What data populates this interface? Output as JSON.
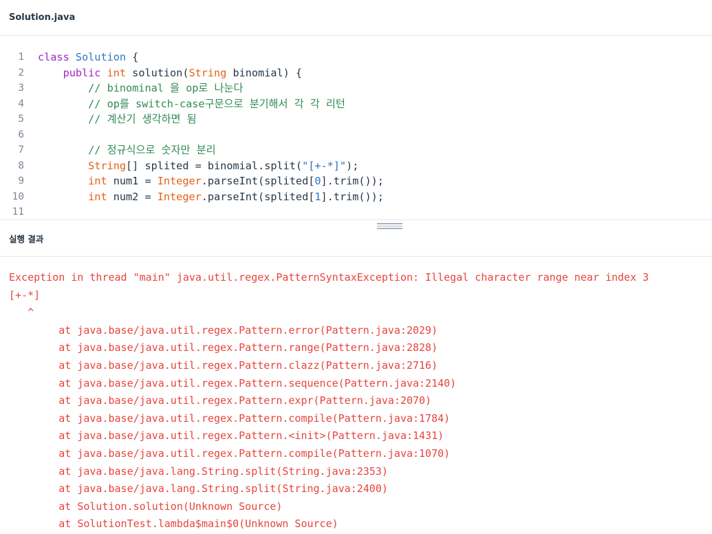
{
  "editor": {
    "file_name": "Solution.java",
    "lines": [
      {
        "no": "1",
        "tokens": [
          {
            "t": "class ",
            "c": "k"
          },
          {
            "t": "Solution",
            "c": "c"
          },
          {
            "t": " {",
            "c": "p"
          }
        ]
      },
      {
        "no": "2",
        "tokens": [
          {
            "t": "    ",
            "c": "p"
          },
          {
            "t": "public ",
            "c": "k"
          },
          {
            "t": "int ",
            "c": "t"
          },
          {
            "t": "solution(",
            "c": "p"
          },
          {
            "t": "String",
            "c": "t"
          },
          {
            "t": " binomial) {",
            "c": "p"
          }
        ]
      },
      {
        "no": "3",
        "tokens": [
          {
            "t": "        // binominal 을 op로 나눈다",
            "c": "m"
          }
        ]
      },
      {
        "no": "4",
        "tokens": [
          {
            "t": "        // op를 switch-case구문으로 분기해서 각 각 리턴",
            "c": "m"
          }
        ]
      },
      {
        "no": "5",
        "tokens": [
          {
            "t": "        // 계산기 생각하면 됨",
            "c": "m"
          }
        ]
      },
      {
        "no": "6",
        "tokens": []
      },
      {
        "no": "7",
        "tokens": [
          {
            "t": "        // 정규식으로 숫자만 분리",
            "c": "m"
          }
        ]
      },
      {
        "no": "8",
        "tokens": [
          {
            "t": "        ",
            "c": "p"
          },
          {
            "t": "String",
            "c": "t"
          },
          {
            "t": "[] splited = binomial.split(",
            "c": "p"
          },
          {
            "t": "\"[+-*]\"",
            "c": "s"
          },
          {
            "t": ");",
            "c": "p"
          }
        ]
      },
      {
        "no": "9",
        "tokens": [
          {
            "t": "        ",
            "c": "p"
          },
          {
            "t": "int",
            "c": "t"
          },
          {
            "t": " num1 = ",
            "c": "p"
          },
          {
            "t": "Integer",
            "c": "t"
          },
          {
            "t": ".parseInt(splited[",
            "c": "p"
          },
          {
            "t": "0",
            "c": "n"
          },
          {
            "t": "].trim());",
            "c": "p"
          }
        ]
      },
      {
        "no": "10",
        "tokens": [
          {
            "t": "        ",
            "c": "p"
          },
          {
            "t": "int",
            "c": "t"
          },
          {
            "t": " num2 = ",
            "c": "p"
          },
          {
            "t": "Integer",
            "c": "t"
          },
          {
            "t": ".parseInt(splited[",
            "c": "p"
          },
          {
            "t": "1",
            "c": "n"
          },
          {
            "t": "].trim());",
            "c": "p"
          }
        ]
      },
      {
        "no": "11",
        "tokens": []
      }
    ]
  },
  "result": {
    "title": "실행 결과",
    "lines": [
      "Exception in thread \"main\" java.util.regex.PatternSyntaxException: Illegal character range near index 3",
      "[+-*]",
      "   ^",
      "        at java.base/java.util.regex.Pattern.error(Pattern.java:2029)",
      "        at java.base/java.util.regex.Pattern.range(Pattern.java:2828)",
      "        at java.base/java.util.regex.Pattern.clazz(Pattern.java:2716)",
      "        at java.base/java.util.regex.Pattern.sequence(Pattern.java:2140)",
      "        at java.base/java.util.regex.Pattern.expr(Pattern.java:2070)",
      "        at java.base/java.util.regex.Pattern.compile(Pattern.java:1784)",
      "        at java.base/java.util.regex.Pattern.<init>(Pattern.java:1431)",
      "        at java.base/java.util.regex.Pattern.compile(Pattern.java:1070)",
      "        at java.base/java.lang.String.split(String.java:2353)",
      "        at java.base/java.lang.String.split(String.java:2400)",
      "        at Solution.solution(Unknown Source)",
      "        at SolutionTest.lambda$main$0(Unknown Source)"
    ]
  },
  "colors": {
    "error_text": "#e6443c",
    "keyword": "#9a2bc2",
    "type": "#e5601a",
    "comment": "#2f8a54"
  }
}
